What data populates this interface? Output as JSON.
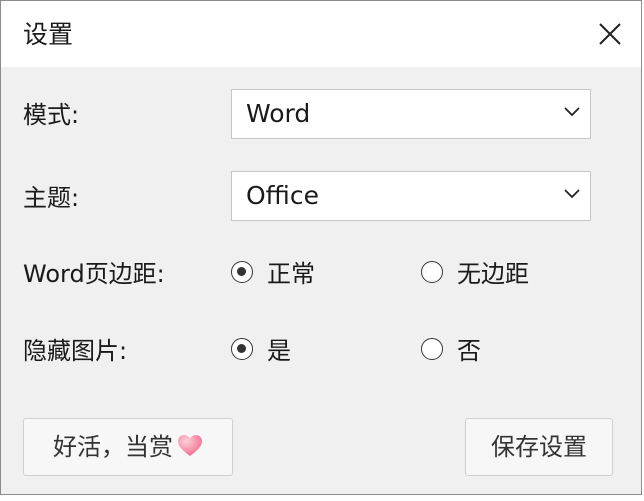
{
  "dialog": {
    "title": "设置"
  },
  "fields": {
    "mode": {
      "label": "模式:",
      "value": "Word"
    },
    "theme": {
      "label": "主题:",
      "value": "Office"
    },
    "margin": {
      "label": "Word页边距:",
      "options": [
        "正常",
        "无边距"
      ],
      "selected": "正常"
    },
    "hide_images": {
      "label": "隐藏图片:",
      "options": [
        "是",
        "否"
      ],
      "selected": "是"
    }
  },
  "buttons": {
    "reward_label": "好活，当赏",
    "save_label": "保存设置"
  },
  "colors": {
    "dialog_bg": "#f0f0f0",
    "titlebar_bg": "#ffffff",
    "heart": "#f06a8c"
  }
}
